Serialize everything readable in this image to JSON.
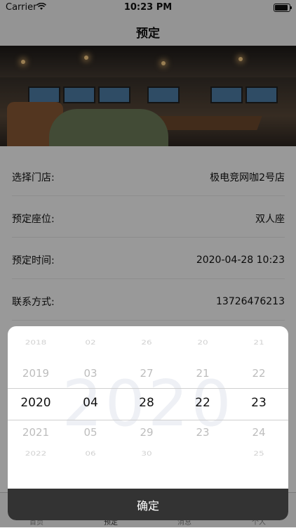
{
  "status": {
    "carrier": "Carrier",
    "time": "10:23 PM"
  },
  "nav": {
    "title": "预定"
  },
  "form": {
    "store_label": "选择门店:",
    "store_value": "极电竞网咖2号店",
    "seat_label": "预定座位:",
    "seat_value": "双人座",
    "time_label": "预定时间:",
    "time_value": "2020-04-28 10:23",
    "contact_label": "联系方式:",
    "contact_value": "13726476213"
  },
  "tabs": [
    "首页",
    "预定",
    "消息",
    "个人"
  ],
  "picker": {
    "watermark": "2020",
    "columns": [
      {
        "name": "year",
        "items": [
          "2018",
          "2019",
          "2020",
          "2021",
          "2022"
        ],
        "selected": "2020"
      },
      {
        "name": "month",
        "items": [
          "02",
          "03",
          "04",
          "05",
          "06"
        ],
        "selected": "04"
      },
      {
        "name": "day",
        "items": [
          "26",
          "27",
          "28",
          "29",
          "30"
        ],
        "selected": "28"
      },
      {
        "name": "hour",
        "items": [
          "20",
          "21",
          "22",
          "23",
          ""
        ],
        "selected": "22"
      },
      {
        "name": "minute",
        "items": [
          "21",
          "22",
          "23",
          "24",
          "25"
        ],
        "selected": "23"
      }
    ],
    "confirm_label": "确定"
  }
}
